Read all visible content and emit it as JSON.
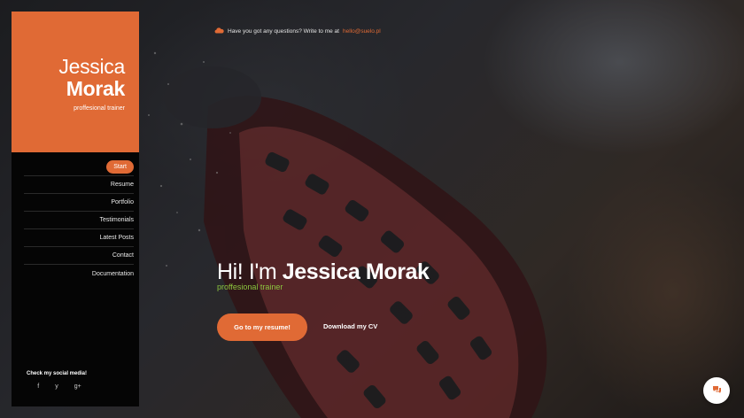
{
  "sidebar": {
    "first_name": "Jessica",
    "last_name": "Morak",
    "role": "proffesional trainer",
    "nav": [
      {
        "label": "Start",
        "active": true
      },
      {
        "label": "Resume",
        "active": false
      },
      {
        "label": "Portfolio",
        "active": false
      },
      {
        "label": "Testimonials",
        "active": false
      },
      {
        "label": "Latest Posts",
        "active": false
      },
      {
        "label": "Contact",
        "active": false
      },
      {
        "label": "Documentation",
        "active": false
      }
    ],
    "social_title": "Check my social media!",
    "social_icons": [
      {
        "name": "facebook-icon",
        "glyph": "f"
      },
      {
        "name": "twitter-icon",
        "glyph": "y"
      },
      {
        "name": "google-plus-icon",
        "glyph": "g+"
      }
    ]
  },
  "topbar": {
    "icon": "cloud-icon",
    "text": "Have you got any questions? Write to me at",
    "email": "hello@suelo.pl"
  },
  "hero": {
    "greeting": "Hi! I'm",
    "name": "Jessica Morak",
    "subtitle": "proffesional trainer",
    "primary_button": "Go to my resume!",
    "secondary_link": "Download my CV"
  },
  "chat": {
    "icon": "chat-icon"
  },
  "colors": {
    "accent": "#e06a35",
    "subtitle_green": "#8dc63f",
    "sidebar_bg": "#050505"
  }
}
